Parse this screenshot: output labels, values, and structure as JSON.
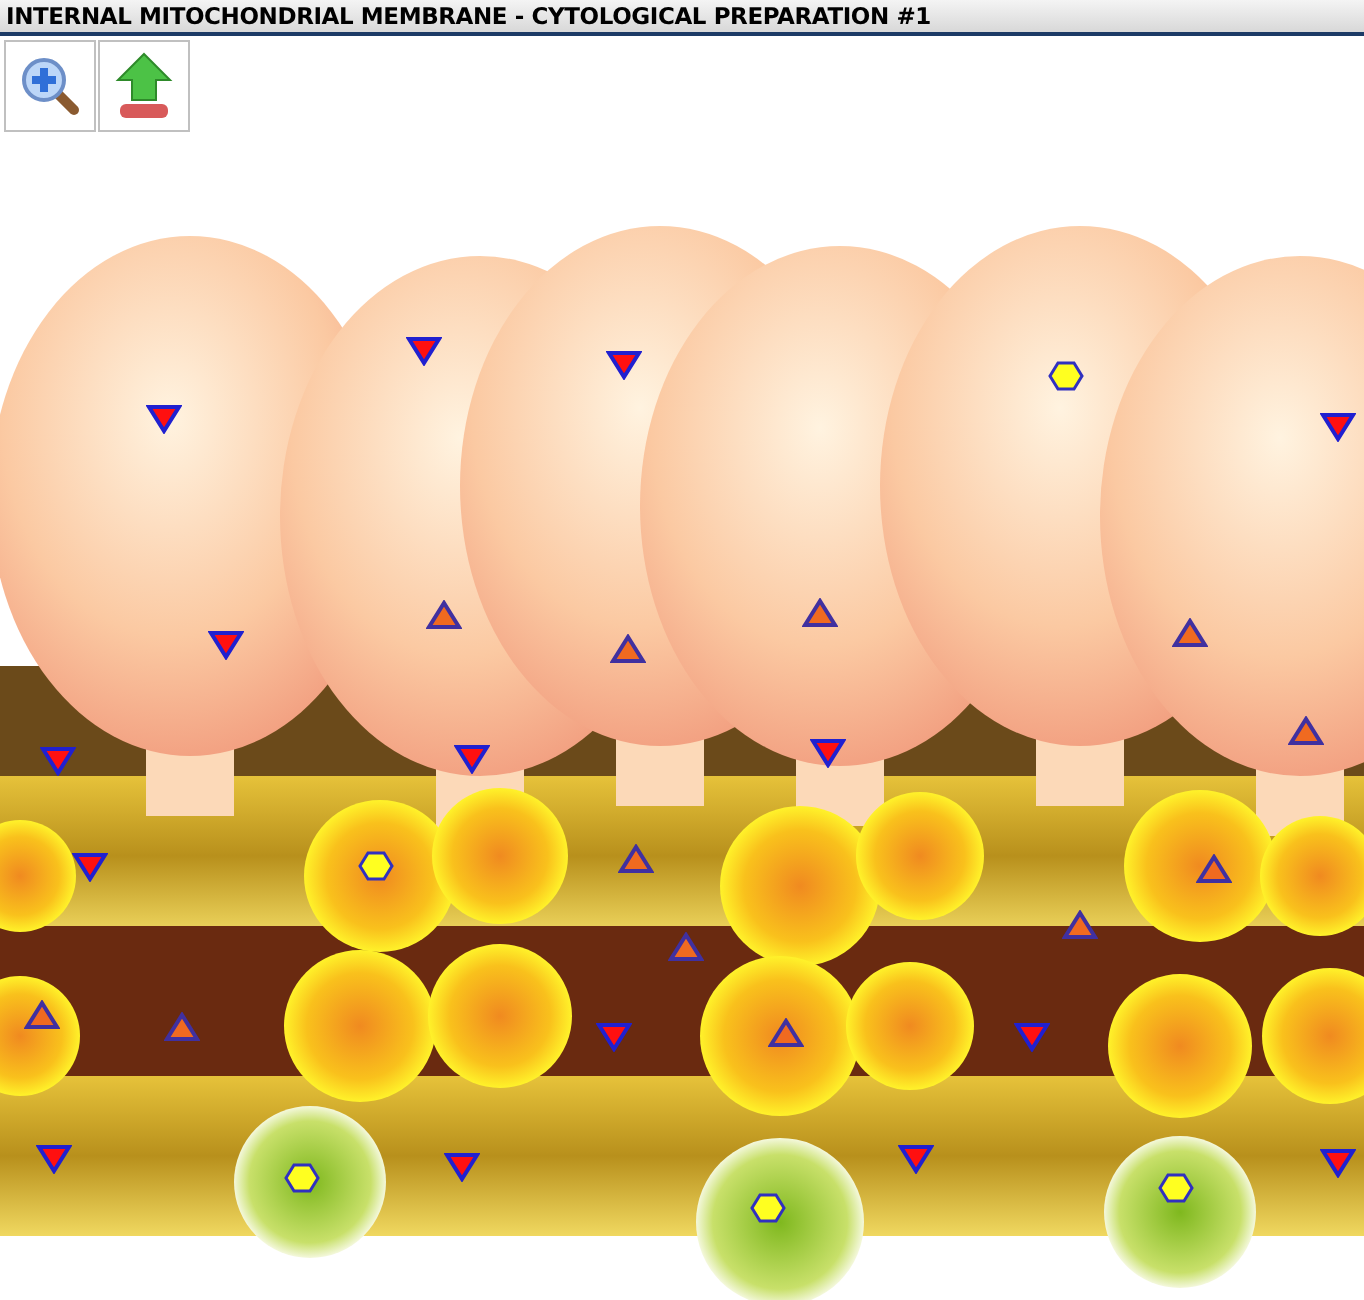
{
  "window": {
    "title": "INTERNAL MITOCHONDRIAL MEMBRANE - CYTOLOGICAL PREPARATION #1"
  },
  "toolbar": [
    {
      "kind": "zoom"
    },
    {
      "kind": "upload"
    }
  ],
  "markers": [
    {
      "kind": "down"
    },
    {
      "kind": "down"
    },
    {
      "kind": "down"
    },
    {
      "kind": "down"
    },
    {
      "kind": "down"
    },
    {
      "kind": "down"
    },
    {
      "kind": "down"
    },
    {
      "kind": "down"
    },
    {
      "kind": "down"
    },
    {
      "kind": "down"
    },
    {
      "kind": "down"
    },
    {
      "kind": "down"
    },
    {
      "kind": "down"
    },
    {
      "kind": "down"
    },
    {
      "kind": "down"
    },
    {
      "kind": "up"
    },
    {
      "kind": "up"
    },
    {
      "kind": "up"
    },
    {
      "kind": "up"
    },
    {
      "kind": "up"
    },
    {
      "kind": "up"
    },
    {
      "kind": "up"
    },
    {
      "kind": "up"
    },
    {
      "kind": "up"
    },
    {
      "kind": "up"
    },
    {
      "kind": "up"
    },
    {
      "kind": "up"
    },
    {
      "kind": "hex"
    },
    {
      "kind": "hex"
    },
    {
      "kind": "hex"
    },
    {
      "kind": "hex"
    },
    {
      "kind": "hex"
    }
  ]
}
